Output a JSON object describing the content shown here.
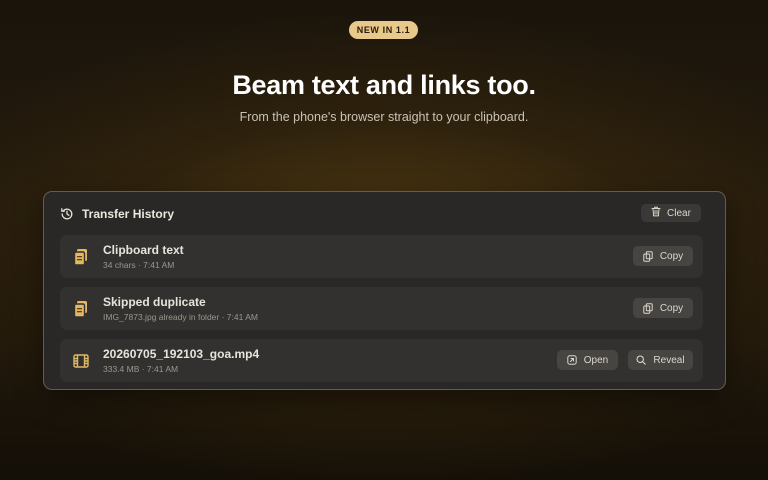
{
  "badge": "NEW IN 1.1",
  "headline": "Beam text and links too.",
  "subhead": "From the phone's browser straight to your clipboard.",
  "panel": {
    "title": "Transfer History",
    "title_icon": "history-icon",
    "clear_label": "Clear",
    "clear_icon": "trash-icon"
  },
  "rows": [
    {
      "name": "Clipboard text",
      "meta": "34 chars · 7:41 AM",
      "icon": "clipboard-icon",
      "actions": [
        {
          "label": "Copy",
          "icon": "copy-icon"
        }
      ]
    },
    {
      "name": "Skipped duplicate",
      "meta": "IMG_7873.jpg already in folder · 7:41 AM",
      "icon": "clipboard-icon",
      "actions": [
        {
          "label": "Copy",
          "icon": "copy-icon"
        }
      ]
    },
    {
      "name": "20260705_192103_goa.mp4",
      "meta": "333.4 MB · 7:41 AM",
      "icon": "film-icon",
      "actions": [
        {
          "label": "Open",
          "icon": "open-icon"
        },
        {
          "label": "Reveal",
          "icon": "search-icon"
        }
      ]
    }
  ],
  "colors": {
    "accent": "#e9c88c",
    "file_icon": "#e2b865"
  }
}
